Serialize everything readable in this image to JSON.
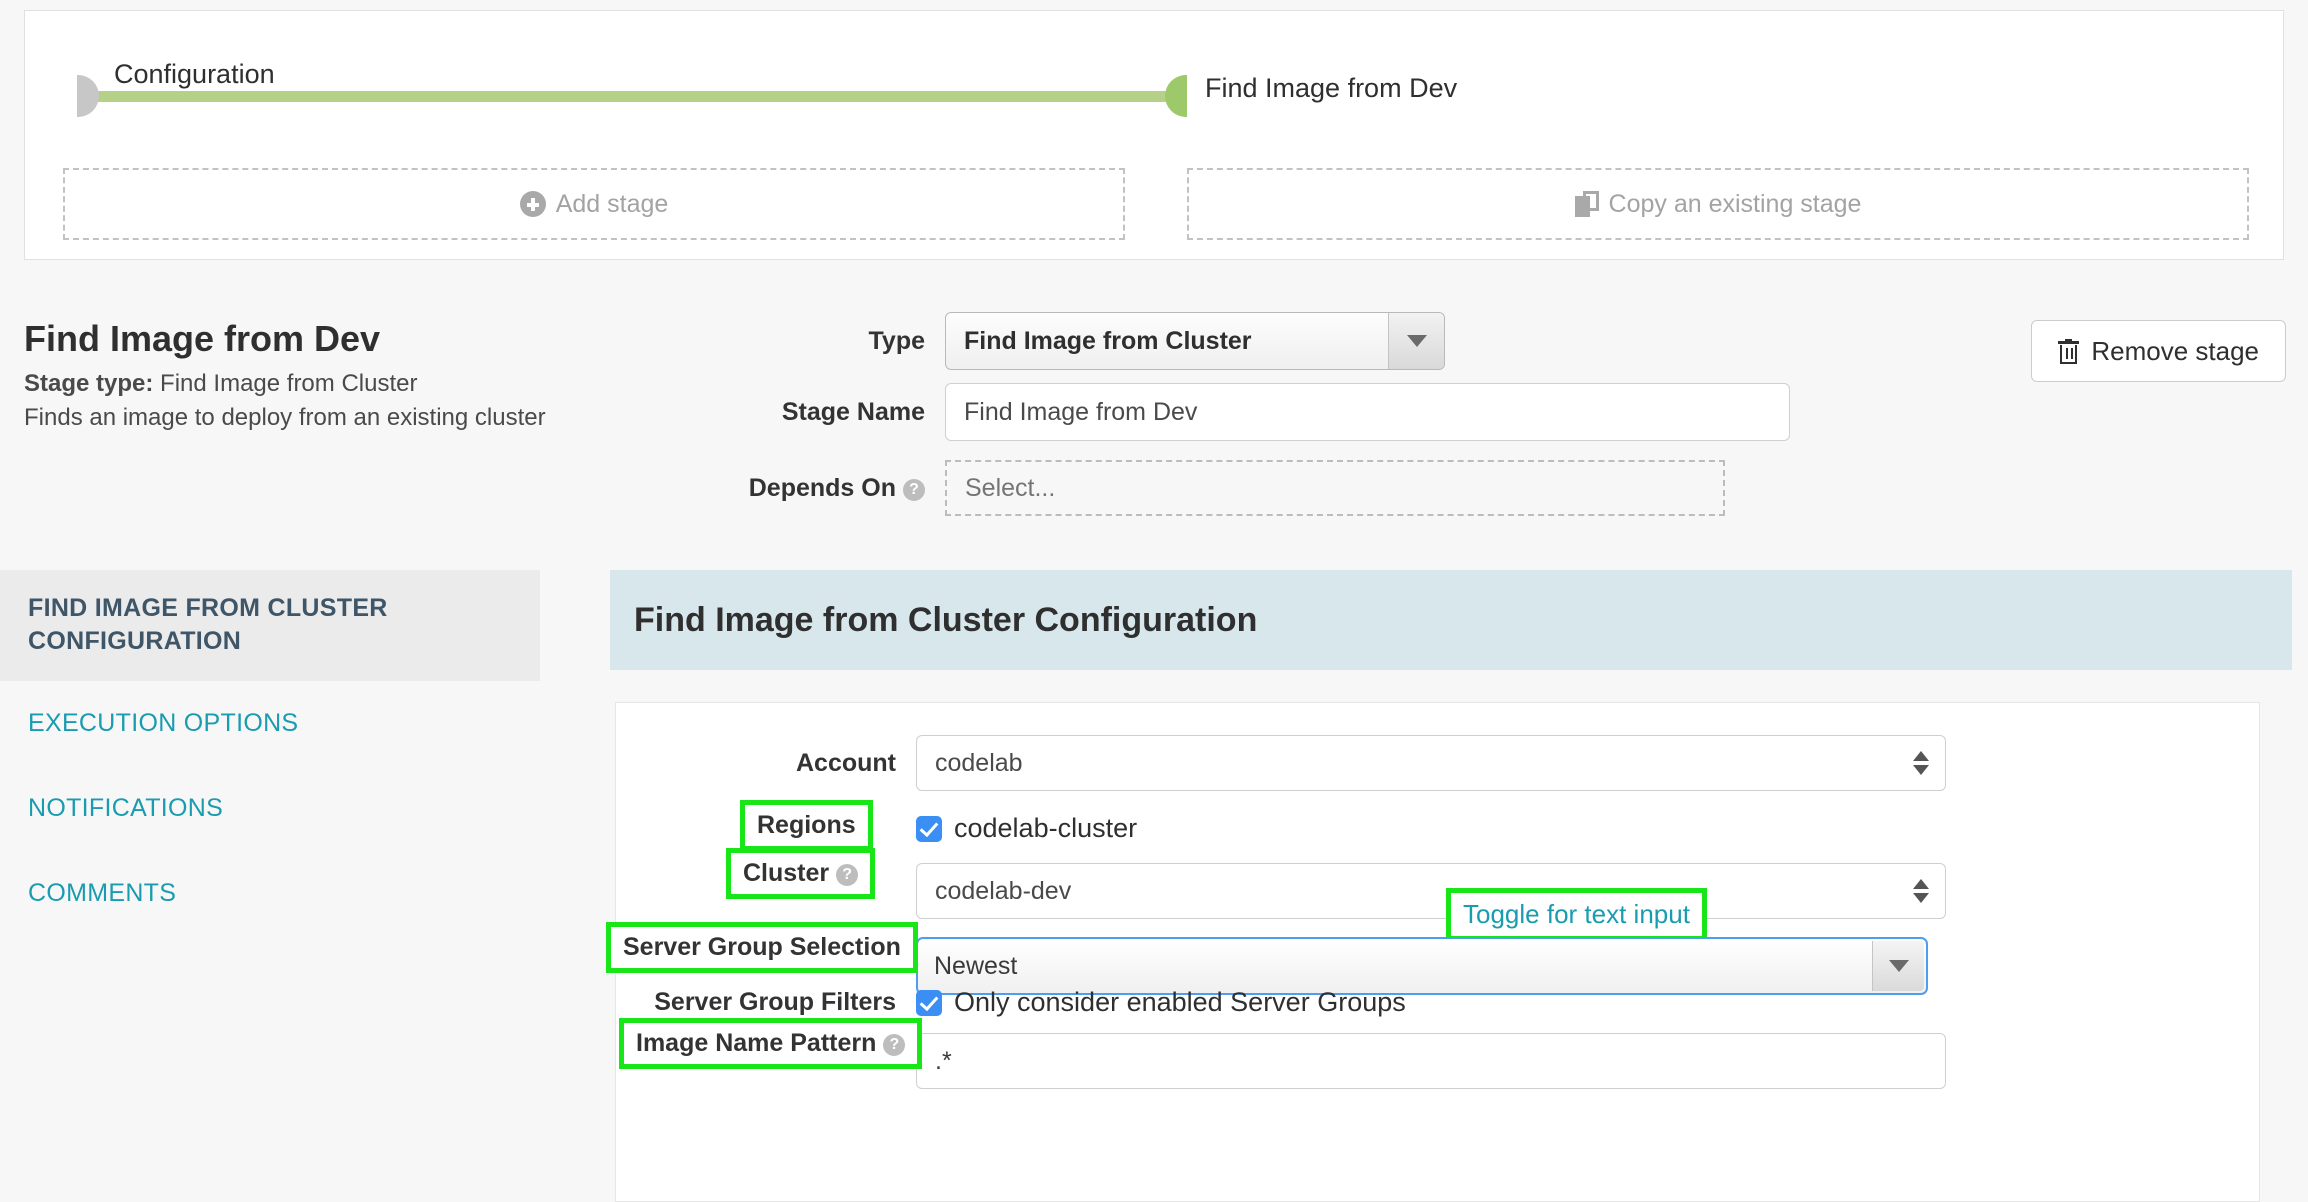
{
  "pipeline": {
    "start_node_label": "Configuration",
    "stage_node_label": "Find Image from Dev",
    "add_stage_label": "Add stage",
    "copy_stage_label": "Copy an existing stage"
  },
  "stage_header": {
    "title": "Find Image from Dev",
    "stage_type_prefix": "Stage type:",
    "stage_type_value": "Find Image from Cluster",
    "description": "Finds an image to deploy from an existing cluster",
    "remove_stage_label": "Remove stage",
    "fields": {
      "type_label": "Type",
      "type_value": "Find Image from Cluster",
      "stage_name_label": "Stage Name",
      "stage_name_value": "Find Image from Dev",
      "depends_on_label": "Depends On",
      "depends_on_placeholder": "Select..."
    }
  },
  "sidebar": {
    "items": [
      {
        "label": "FIND IMAGE FROM CLUSTER CONFIGURATION",
        "active": true
      },
      {
        "label": "EXECUTION OPTIONS",
        "active": false
      },
      {
        "label": "NOTIFICATIONS",
        "active": false
      },
      {
        "label": "COMMENTS",
        "active": false
      }
    ]
  },
  "config_panel": {
    "header": "Find Image from Cluster Configuration",
    "account_label": "Account",
    "account_value": "codelab",
    "regions_label": "Regions",
    "regions_checkbox_label": "codelab-cluster",
    "cluster_label": "Cluster",
    "cluster_value": "codelab-dev",
    "toggle_text_input_label": "Toggle for text input",
    "server_group_selection_label": "Server Group Selection",
    "server_group_selection_value": "Newest",
    "server_group_filters_label": "Server Group Filters",
    "server_group_filters_checkbox_label": "Only consider enabled Server Groups",
    "image_name_pattern_label": "Image Name Pattern",
    "image_name_pattern_value": ".*"
  },
  "colors": {
    "pipeline_green": "#b5d187",
    "node_green": "#9ec96a",
    "node_grey": "#c7c7c7",
    "highlight_green": "#18e618",
    "link_teal": "#1a9cb0",
    "panel_header_blue": "#d8e7ec",
    "checkbox_blue": "#3b8ef3",
    "focus_blue": "#4f9df0",
    "sidebar_active_text": "#3f5668"
  },
  "icons": {
    "add": "plus-circle-icon",
    "copy": "copy-icon",
    "remove": "trash-icon",
    "help": "help-circle-icon",
    "caret": "chevron-down-icon",
    "spinner": "spinner-arrows-icon"
  }
}
